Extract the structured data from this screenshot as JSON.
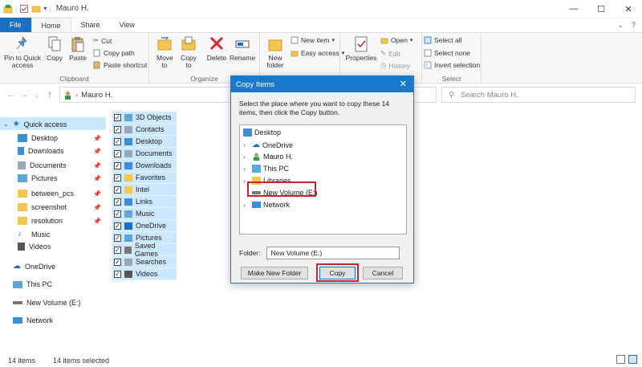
{
  "window": {
    "title": "Mauro H.",
    "controls": {
      "minimize": "—",
      "maximize": "☐",
      "close": "✕"
    }
  },
  "tabs": [
    "File",
    "Home",
    "Share",
    "View"
  ],
  "ribbon": {
    "clipboard": {
      "label": "Clipboard",
      "pin": "Pin to Quick access",
      "copy": "Copy",
      "paste": "Paste",
      "cut": "Cut",
      "copy_path": "Copy path",
      "paste_shortcut": "Paste shortcut"
    },
    "organize": {
      "label": "Organize",
      "move_to": "Move to",
      "copy_to": "Copy to",
      "delete": "Delete",
      "rename": "Rename"
    },
    "new": {
      "new_folder": "New folder",
      "new_item": "New item",
      "easy_access": "Easy access"
    },
    "open": {
      "properties": "Properties",
      "open": "Open",
      "edit": "Edit",
      "history": "History"
    },
    "select": {
      "label": "Select",
      "select_all": "Select all",
      "select_none": "Select none",
      "invert": "Invert selection"
    }
  },
  "address": {
    "path": "Mauro H.",
    "search_placeholder": "Search Mauro H."
  },
  "navpane": [
    {
      "label": "Quick access",
      "pinned": false
    },
    {
      "label": "Desktop",
      "pinned": true
    },
    {
      "label": "Downloads",
      "pinned": true
    },
    {
      "label": "Documents",
      "pinned": true
    },
    {
      "label": "Pictures",
      "pinned": true
    },
    {
      "label": "between_pcs",
      "pinned": true
    },
    {
      "label": "screenshot",
      "pinned": true
    },
    {
      "label": "resolution",
      "pinned": true
    },
    {
      "label": "Music",
      "pinned": false
    },
    {
      "label": "Videos",
      "pinned": false
    },
    {
      "label": "OneDrive",
      "pinned": false
    },
    {
      "label": "This PC",
      "pinned": false
    },
    {
      "label": "New Volume (E:)",
      "pinned": false
    },
    {
      "label": "Network",
      "pinned": false
    }
  ],
  "files": [
    "3D Objects",
    "Contacts",
    "Desktop",
    "Documents",
    "Downloads",
    "Favorites",
    "Intel",
    "Links",
    "Music",
    "OneDrive",
    "Pictures",
    "Saved Games",
    "Searches",
    "Videos"
  ],
  "status": {
    "count": "14 items",
    "selected": "14 items selected"
  },
  "dialog": {
    "title": "Copy Items",
    "message": "Select the place where you want to copy these 14 items, then click the Copy button.",
    "tree": [
      "Desktop",
      "OneDrive",
      "Mauro H.",
      "This PC",
      "Libraries",
      "New Volume (E:)",
      "Network"
    ],
    "folder_label": "Folder:",
    "folder_value": "New Volume (E:)",
    "make_new_folder": "Make New Folder",
    "copy": "Copy",
    "cancel": "Cancel"
  },
  "colors": {
    "accent": "#1979ca",
    "selection": "#cce8ff",
    "highlight": "#c62434",
    "folder": "#f3c64d"
  }
}
